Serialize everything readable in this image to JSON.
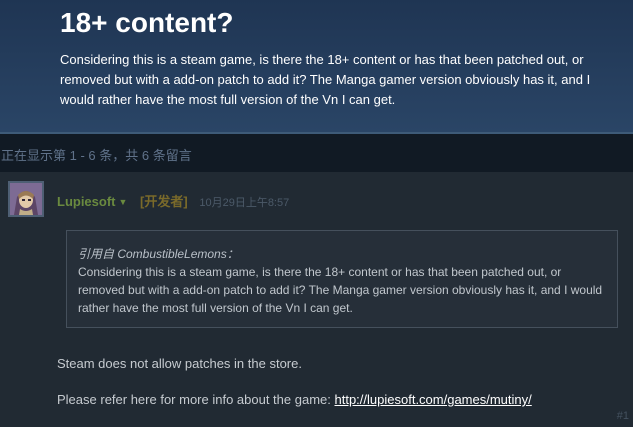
{
  "topic": {
    "title": "18+ content?",
    "body": "Considering this is a steam game, is there the 18+ content or has that been patched out, or removed but with a add-on patch to add it? The Manga gamer version obviously has it, and I would rather have the most full version of the Vn I can get."
  },
  "paging": {
    "text": "正在显示第 1 - 6 条，共 6 条留言"
  },
  "comment": {
    "author": "Lupiesoft",
    "badge": "[开发者]",
    "timestamp": "10月29日上午8:57",
    "quote": {
      "author_line": "引用自 CombustibleLemons：",
      "text": "Considering this is a steam game, is there the 18+ content or has that been patched out, or removed but with a add-on patch to add it? The Manga gamer version obviously has it, and I would rather have the most full version of the Vn I can get."
    },
    "reply_line_1": "Steam does not allow patches in the store.",
    "reply_line_2_prefix": "Please refer here for more info about the game: ",
    "reply_link": "http://lupiesoft.com/games/mutiny/",
    "index": "#1"
  },
  "colors": {
    "page_background": "#1b2838",
    "header_background": "#2a4566",
    "developer_name": "#6a8a3f",
    "developer_badge": "#7a6a2a",
    "link": "#ffffff"
  },
  "icons": {
    "author_menu": "caret-down-icon"
  }
}
